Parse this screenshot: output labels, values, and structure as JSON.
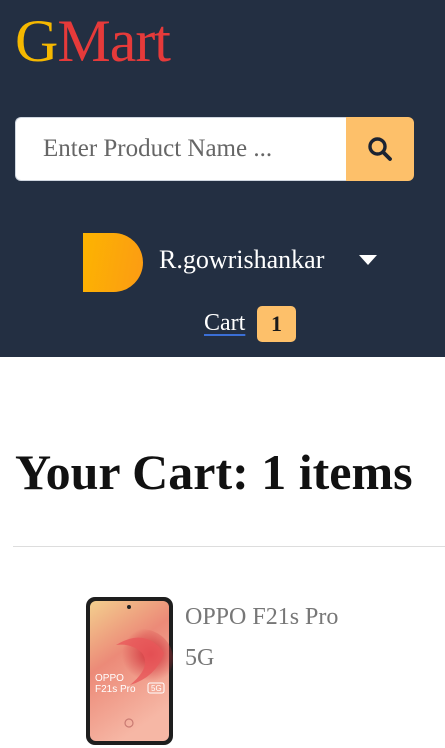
{
  "brand": {
    "logo_first": "G",
    "logo_rest": "Mart",
    "logo_first_color": "#f5b800",
    "logo_rest_color": "#e63a3a"
  },
  "search": {
    "placeholder": "Enter Product Name ...",
    "value": "",
    "button_icon": "search-icon"
  },
  "user": {
    "name": "R.gowrishankar",
    "avatar_icon": "avatar",
    "menu_icon": "caret-down-icon"
  },
  "cart": {
    "label": "Cart",
    "count": "1"
  },
  "cart_page": {
    "heading_prefix": "Your Cart: ",
    "heading_count": "1 items"
  },
  "items": [
    {
      "name": "OPPO F21s Pro 5G",
      "image_text_brand": "OPPO",
      "image_text_model": "F21s Pro",
      "image_text_badge": "5G"
    }
  ],
  "colors": {
    "header_bg": "#232f42",
    "accent": "#fdc06a"
  }
}
